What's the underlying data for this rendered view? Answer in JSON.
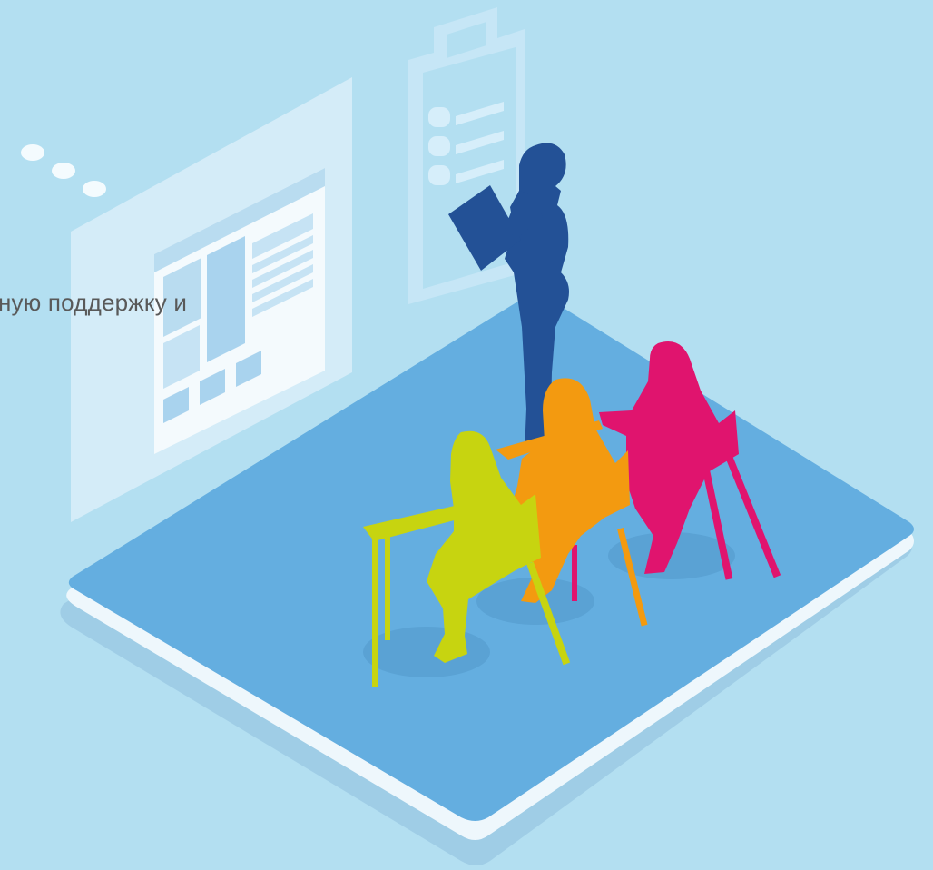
{
  "caption": {
    "text": "ную поддержку и"
  },
  "colors": {
    "background": "#b3dff1",
    "platform_top": "#64aee0",
    "platform_edge": "#eef7fc",
    "platform_shadow": "#9fcde6",
    "teacher": "#235196",
    "student_yellow": "#c7d410",
    "student_orange": "#f39a10",
    "student_pink": "#e0146e",
    "panel": "#d9eef8",
    "panel_detail": "#8fc7e6"
  },
  "scene": {
    "icons": [
      "ellipsis-dots-icon",
      "screen-board-icon",
      "clipboard-icon"
    ],
    "figures": [
      "teacher-silhouette",
      "student-yellow",
      "student-orange",
      "student-pink"
    ]
  }
}
